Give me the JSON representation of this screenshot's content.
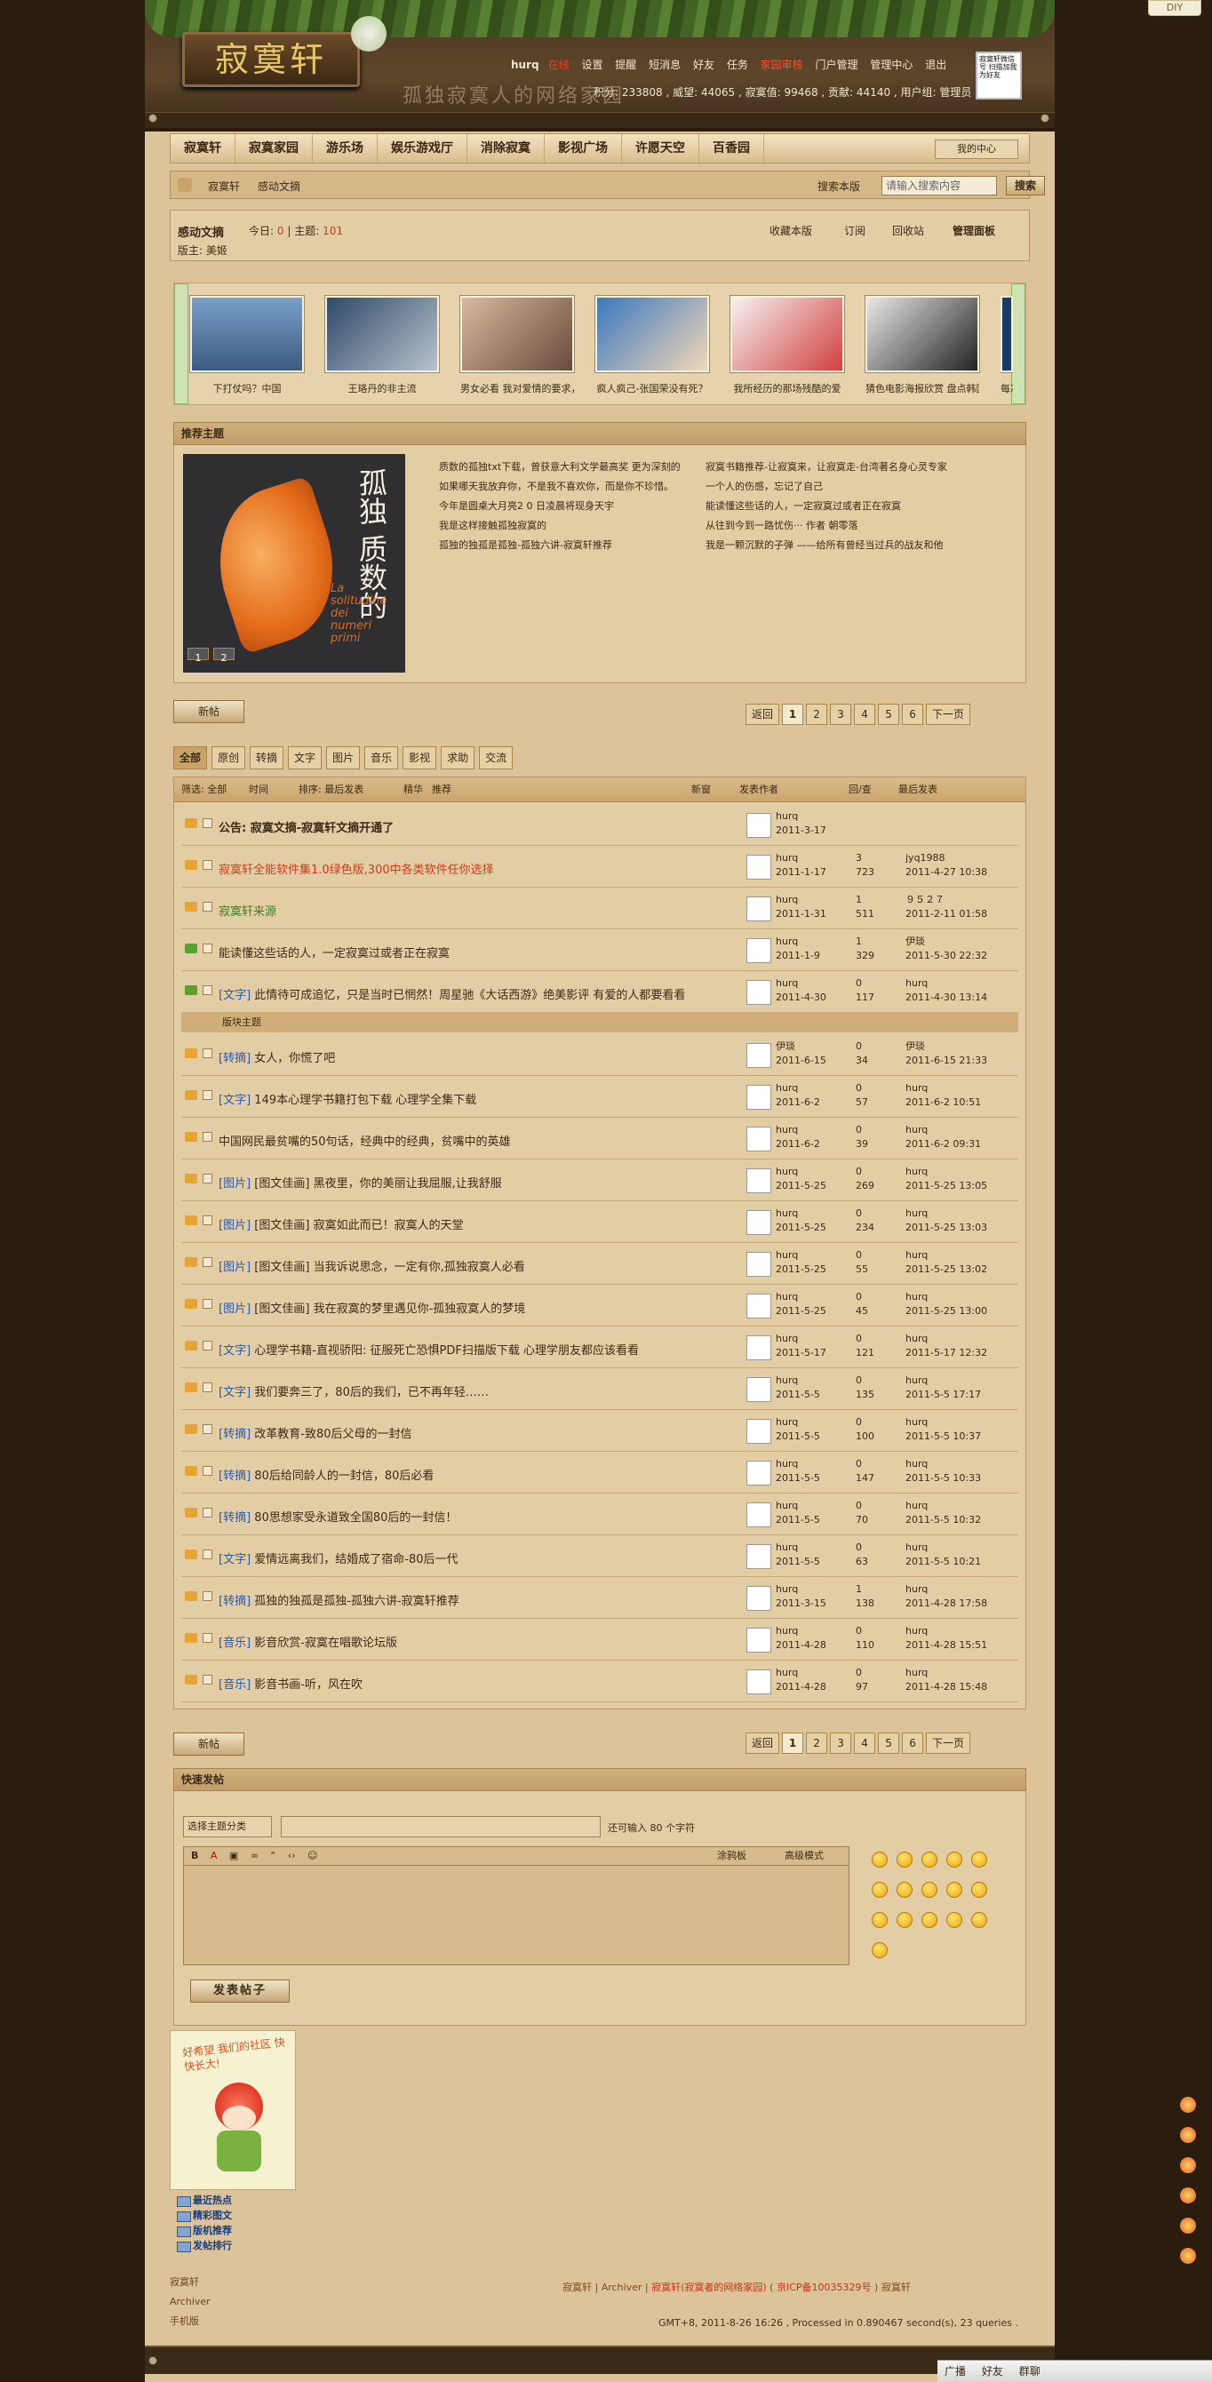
{
  "diy_label": "DIY",
  "site": {
    "logo_text": "寂寞轩",
    "slogan": "孤独寂寞人的网络家园"
  },
  "topnav": {
    "user": "hurq",
    "online": "在线",
    "items": [
      "设置",
      "提醒",
      "短消息",
      "好友",
      "任务",
      "退出"
    ],
    "mod_item": "家园审核",
    "portal": "门户管理",
    "admin": "管理中心"
  },
  "stats": "积分: 233808 , 威望: 44065 , 寂寞值: 99468 , 贡献: 44140 , 用户组: 管理员",
  "qr_text": "寂寞轩微信号 扫描加我为好友",
  "nav": {
    "items": [
      "寂寞轩",
      "寂寞家园",
      "游乐场",
      "娱乐游戏厅",
      "消除寂寞",
      "影视广场",
      "许愿天空",
      "百香园"
    ],
    "my_center": "我的中心"
  },
  "breadcrumb": {
    "items": [
      "寂寞轩",
      "感动文摘"
    ],
    "search_scope": "搜索本版",
    "search_placeholder": "请输入搜索内容",
    "search_button": "搜索"
  },
  "forum": {
    "title": "感动文摘",
    "today_label": "今日:",
    "today_value": "0",
    "threads_label": "主题:",
    "threads_value": "101",
    "moderator": "版主: 美姬",
    "actions": [
      "收藏本版",
      "订阅",
      "回收站",
      "管理面板"
    ]
  },
  "slides": [
    "下打仗吗？中国",
    "王珞丹的非主流",
    "男女必看 我对爱情的要求，",
    "疯人疯己-张国荣没有死？",
    "我所经历的那场残酷的爱",
    "猜色电影海报欣赏 盘点韩国",
    "每次只"
  ],
  "recommend": {
    "title": "推荐主题",
    "book_title": "孤独 质数的",
    "book_sub": "La solitudine dei numeri primi",
    "pages": [
      "1",
      "2"
    ],
    "links": [
      "质数的孤独txt下载，曾获意大利文学最高奖 更为深刻的",
      "寂寞书籍推荐-让寂寞来，让寂寞走-台湾著名身心灵专家",
      "如果哪天我放弃你，不是我不喜欢你，而是你不珍惜。",
      "一个人的伤感，忘记了自己",
      "今年是圆桌大月亮2 0 日凌晨将现身天宇",
      "能读懂这些话的人，一定寂寞过或者正在寂寞",
      "我是这样接触孤独寂寞的",
      "从往到今到一路忧伤··· 作者 朝零落",
      "孤独的独孤是孤独-孤独六讲-寂寞轩推荐",
      "我是一颗沉默的子弹 ——给所有曾经当过兵的战友和他"
    ]
  },
  "pager": {
    "new_post": "新帖",
    "prev": "返回",
    "pages": [
      "1",
      "2",
      "3",
      "4",
      "5",
      "6"
    ],
    "next": "下一页"
  },
  "tabs": [
    "全部",
    "原创",
    "转摘",
    "文字",
    "图片",
    "音乐",
    "影视",
    "求助",
    "交流"
  ],
  "filter": {
    "filter_label": "筛选: 全部",
    "time": "时间",
    "sort": "排序: 最后发表",
    "digest": "精华",
    "recommend": "推荐",
    "new_window": "新窗",
    "col_author": "发表作者",
    "col_reply": "回/查",
    "col_last": "最后发表"
  },
  "threads_top": [
    {
      "tag": "",
      "title": "公告: 寂寞文摘-寂寞轩文摘开通了",
      "style": "bold",
      "author": "hurq",
      "date": "2011-3-17",
      "replies": "",
      "views": "",
      "last_user": "",
      "last_time": ""
    },
    {
      "tag": "",
      "title": "寂寞轩全能软件集1.0绿色版,300中各类软件任你选择",
      "style": "red",
      "author": "hurq",
      "date": "2011-1-17",
      "replies": "3",
      "views": "723",
      "last_user": "jyq1988",
      "last_time": "2011-4-27 10:38"
    },
    {
      "tag": "",
      "title": "寂寞轩来源",
      "style": "green",
      "author": "hurq",
      "date": "2011-1-31",
      "replies": "1",
      "views": "511",
      "last_user": "９５２７",
      "last_time": "2011-2-11 01:58"
    },
    {
      "tag": "",
      "title": "能读懂这些话的人，一定寂寞过或者正在寂寞",
      "style": "",
      "author": "hurq",
      "date": "2011-1-9",
      "replies": "1",
      "views": "329",
      "last_user": "伊琰",
      "last_time": "2011-5-30 22:32"
    },
    {
      "tag": "[文字]",
      "title": "此情待可成追忆，只是当时已惘然！周星驰《大话西游》绝美影评 有爱的人都要看看",
      "style": "",
      "author": "hurq",
      "date": "2011-4-30",
      "replies": "0",
      "views": "117",
      "last_user": "hurq",
      "last_time": "2011-4-30 13:14"
    }
  ],
  "sep_label": "版块主题",
  "threads": [
    {
      "tag": "[转摘]",
      "title": "女人，你慌了吧",
      "author": "伊琰",
      "date": "2011-6-15",
      "replies": "0",
      "views": "34",
      "last_user": "伊琰",
      "last_time": "2011-6-15 21:33"
    },
    {
      "tag": "[文字]",
      "title": "149本心理学书籍打包下载 心理学全集下载",
      "author": "hurq",
      "date": "2011-6-2",
      "replies": "0",
      "views": "57",
      "last_user": "hurq",
      "last_time": "2011-6-2 10:51"
    },
    {
      "tag": "",
      "title": "中国网民最贫嘴的50句话，经典中的经典，贫嘴中的英雄",
      "author": "hurq",
      "date": "2011-6-2",
      "replies": "0",
      "views": "39",
      "last_user": "hurq",
      "last_time": "2011-6-2 09:31"
    },
    {
      "tag": "[图片]",
      "title": "[图文佳画] 黑夜里，你的美丽让我屈服,让我舒服",
      "author": "hurq",
      "date": "2011-5-25",
      "replies": "0",
      "views": "269",
      "last_user": "hurq",
      "last_time": "2011-5-25 13:05"
    },
    {
      "tag": "[图片]",
      "title": "[图文佳画] 寂寞如此而已！寂寞人的天堂",
      "author": "hurq",
      "date": "2011-5-25",
      "replies": "0",
      "views": "234",
      "last_user": "hurq",
      "last_time": "2011-5-25 13:03"
    },
    {
      "tag": "[图片]",
      "title": "[图文佳画] 当我诉说思念，一定有你,孤独寂寞人必看",
      "author": "hurq",
      "date": "2011-5-25",
      "replies": "0",
      "views": "55",
      "last_user": "hurq",
      "last_time": "2011-5-25 13:02"
    },
    {
      "tag": "[图片]",
      "title": "[图文佳画] 我在寂寞的梦里遇见你-孤独寂寞人的梦境",
      "author": "hurq",
      "date": "2011-5-25",
      "replies": "0",
      "views": "45",
      "last_user": "hurq",
      "last_time": "2011-5-25 13:00"
    },
    {
      "tag": "[文字]",
      "title": "心理学书籍-直视骄阳: 征服死亡恐惧PDF扫描版下载 心理学朋友都应该看看",
      "author": "hurq",
      "date": "2011-5-17",
      "replies": "0",
      "views": "121",
      "last_user": "hurq",
      "last_time": "2011-5-17 12:32"
    },
    {
      "tag": "[文字]",
      "title": "我们要奔三了，80后的我们，已不再年轻……",
      "author": "hurq",
      "date": "2011-5-5",
      "replies": "0",
      "views": "135",
      "last_user": "hurq",
      "last_time": "2011-5-5 17:17"
    },
    {
      "tag": "[转摘]",
      "title": "改革教育-致80后父母的一封信",
      "author": "hurq",
      "date": "2011-5-5",
      "replies": "0",
      "views": "100",
      "last_user": "hurq",
      "last_time": "2011-5-5 10:37"
    },
    {
      "tag": "[转摘]",
      "title": "80后给同龄人的一封信，80后必看",
      "author": "hurq",
      "date": "2011-5-5",
      "replies": "0",
      "views": "147",
      "last_user": "hurq",
      "last_time": "2011-5-5 10:33"
    },
    {
      "tag": "[转摘]",
      "title": "80思想家受永道致全国80后的一封信！",
      "author": "hurq",
      "date": "2011-5-5",
      "replies": "0",
      "views": "70",
      "last_user": "hurq",
      "last_time": "2011-5-5 10:32"
    },
    {
      "tag": "[文字]",
      "title": "爱情远离我们，结婚成了宿命-80后一代",
      "author": "hurq",
      "date": "2011-5-5",
      "replies": "0",
      "views": "63",
      "last_user": "hurq",
      "last_time": "2011-5-5 10:21"
    },
    {
      "tag": "[转摘]",
      "title": "孤独的独孤是孤独-孤独六讲-寂寞轩推荐",
      "author": "hurq",
      "date": "2011-3-15",
      "replies": "1",
      "views": "138",
      "last_user": "hurq",
      "last_time": "2011-4-28 17:58"
    },
    {
      "tag": "[音乐]",
      "title": "影音欣赏-寂寞在唱歌论坛版",
      "author": "hurq",
      "date": "2011-4-28",
      "replies": "0",
      "views": "110",
      "last_user": "hurq",
      "last_time": "2011-4-28 15:51"
    },
    {
      "tag": "[音乐]",
      "title": "影音书画-听，风在吹",
      "author": "hurq",
      "date": "2011-4-28",
      "replies": "0",
      "views": "97",
      "last_user": "hurq",
      "last_time": "2011-4-28 15:48"
    }
  ],
  "quickpost": {
    "title": "快速发帖",
    "select": "选择主题分类",
    "limit": "还可输入 80 个字符",
    "editor_mode": "高级模式",
    "sketch": "涂鸦板",
    "submit": "发表帖子"
  },
  "cartoon_text": "好希望 我们的社区 快快长大!",
  "side_links": [
    "最近热点",
    "精彩图文",
    "版机推荐",
    "发帖排行"
  ],
  "footer": {
    "left": [
      "寂寞轩",
      "Archiver",
      "手机版"
    ],
    "links": [
      "寂寞轩",
      "Archiver",
      "寂寞轩(寂寞者的网络家园)",
      "京ICP备10035329号",
      "寂寞轩"
    ],
    "gmt": "GMT+8, 2011-8-26 16:26 , Processed in 0.890467 second(s), 23 queries ."
  },
  "taskbar": [
    "广播",
    "好友",
    "群聊"
  ]
}
